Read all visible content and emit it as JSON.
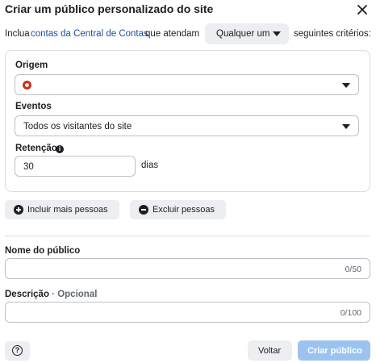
{
  "dialog": {
    "title": "Criar um público personalizado do site"
  },
  "include": {
    "prefix": "Inclua",
    "link": "contas da Central de Contas",
    "middle": "que atendam",
    "match_value": "Qualquer um",
    "suffix": "seguintes critérios:"
  },
  "criteria": {
    "origin_label": "Origem",
    "origin_value": "",
    "events_label": "Eventos",
    "events_value": "Todos os visitantes do site",
    "retention_label": "Retenção",
    "retention_value": "30",
    "retention_unit": "dias"
  },
  "actions": {
    "include_more": "Incluir mais pessoas",
    "exclude": "Excluir pessoas"
  },
  "name_field": {
    "label": "Nome do público",
    "value": "",
    "counter": "0/50"
  },
  "description_field": {
    "label": "Descrição",
    "optional": " · Opcional",
    "value": "",
    "counter": "0/100"
  },
  "footer": {
    "back": "Voltar",
    "create": "Criar público"
  },
  "icons": {
    "close": "close-icon",
    "caret": "caret-down-icon",
    "info": "info-icon",
    "plus": "plus-circle-icon",
    "minus": "minus-circle-icon",
    "help": "help-icon",
    "origin": "pixel-source-icon"
  },
  "colors": {
    "link": "#1a4fa0",
    "primary_disabled": "#9cc3f0",
    "origin_dot": "#c8331f"
  }
}
